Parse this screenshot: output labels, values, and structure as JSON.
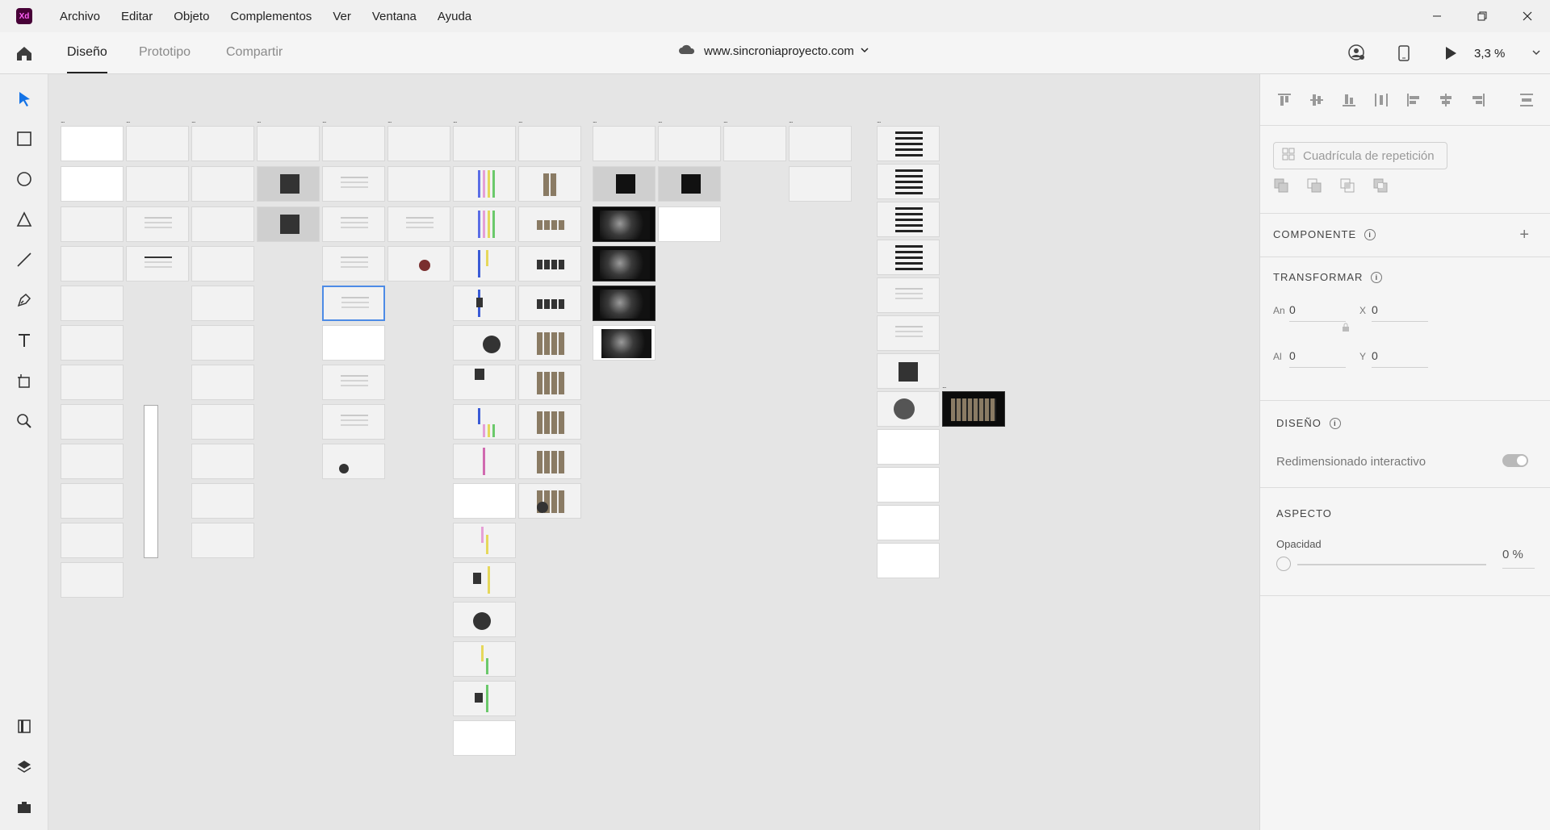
{
  "app": {
    "logo": "Xd"
  },
  "menu": [
    "Archivo",
    "Editar",
    "Objeto",
    "Complementos",
    "Ver",
    "Ventana",
    "Ayuda"
  ],
  "window_controls": {
    "minimize": "minimize-icon",
    "restore": "restore-icon",
    "close": "close-icon"
  },
  "modes": {
    "design": "Diseño",
    "prototype": "Prototipo",
    "share": "Compartir",
    "active": "design"
  },
  "document": {
    "title": "www.sincroniaproyecto.com"
  },
  "toolbar_right": {
    "zoom": "3,3 %"
  },
  "left_tools": [
    "select-icon",
    "rectangle-icon",
    "ellipse-icon",
    "polygon-icon",
    "line-icon",
    "pen-icon",
    "text-icon",
    "artboard-icon",
    "zoom-icon",
    "assets-icon",
    "layers-icon",
    "plugins-icon"
  ],
  "canvas": {
    "artboard_marker": "..."
  },
  "panel": {
    "repeat_grid": "Cuadrícula de repetición",
    "component": {
      "title": "COMPONENTE",
      "add": "+"
    },
    "transform": {
      "title": "TRANSFORMAR",
      "w_label": "An",
      "w_val": "0",
      "x_label": "X",
      "x_val": "0",
      "h_label": "Al",
      "h_val": "0",
      "y_label": "Y",
      "y_val": "0"
    },
    "layout": {
      "title": "DISEÑO",
      "responsive": "Redimensionado interactivo",
      "responsive_on": false
    },
    "appearance": {
      "title": "ASPECTO",
      "opacity_label": "Opacidad",
      "opacity_value": "0 %",
      "opacity_level": 0
    }
  },
  "colors": {
    "accent": "#4d8be6",
    "logo_bg": "#470137",
    "logo_fg": "#ff61f6"
  }
}
